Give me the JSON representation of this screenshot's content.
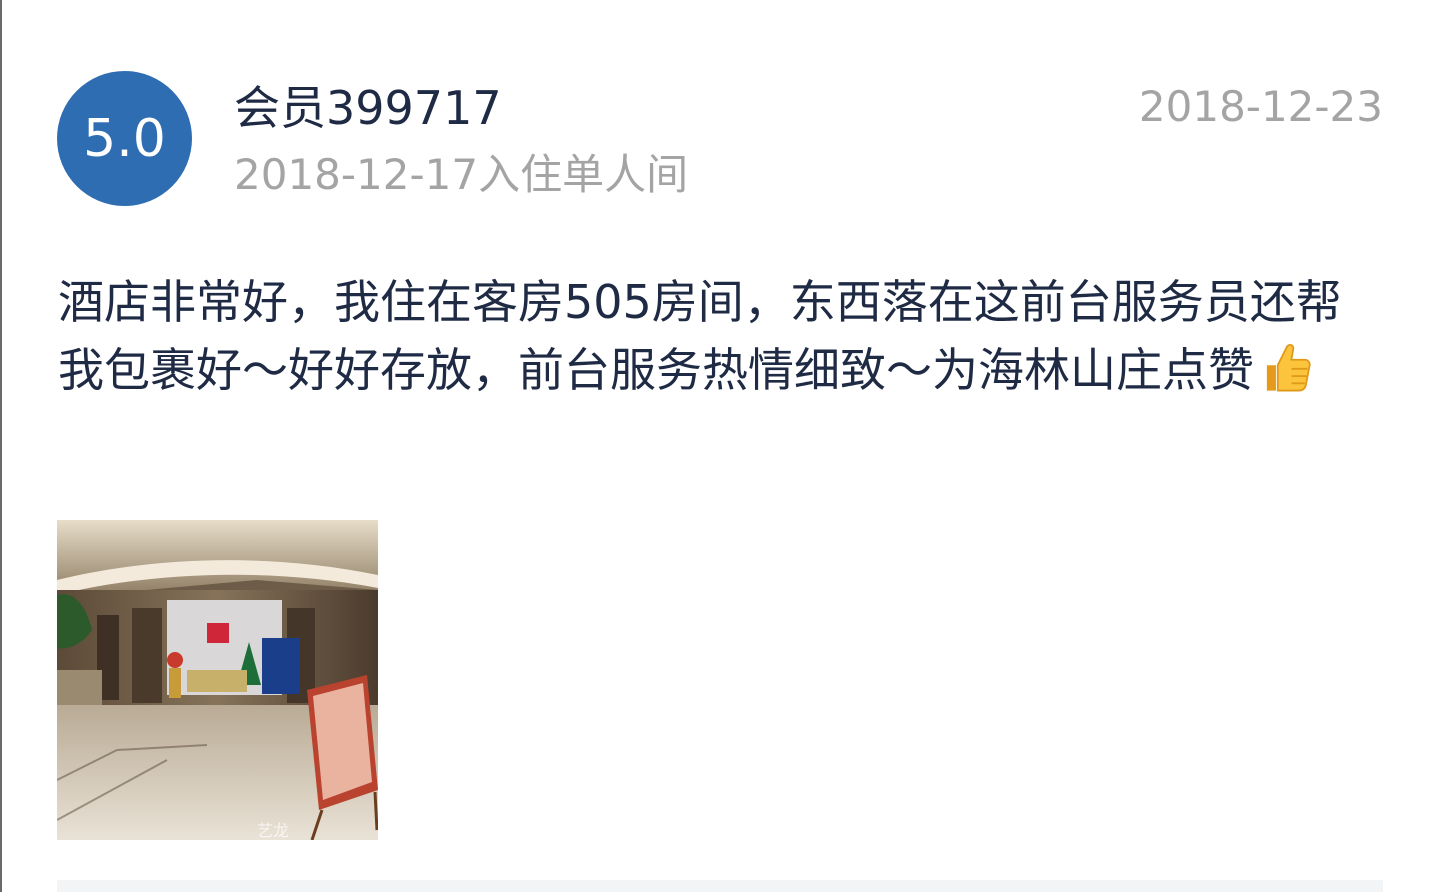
{
  "review": {
    "score": "5.0",
    "username": "会员399717",
    "stay_info": "2018-12-17入住单人间",
    "date": "2018-12-23",
    "text": "酒店非常好，我住在客房505房间，东西落在这前台服务员还帮我包裹好～好好存放，前台服务热情细致～为海林山庄点赞",
    "emoji": "thumbs-up-icon",
    "photo_watermark": "艺龙"
  },
  "colors": {
    "score_badge": "#2f6db3",
    "primary_text": "#1f2a44",
    "secondary_text": "#a4a4a4"
  }
}
